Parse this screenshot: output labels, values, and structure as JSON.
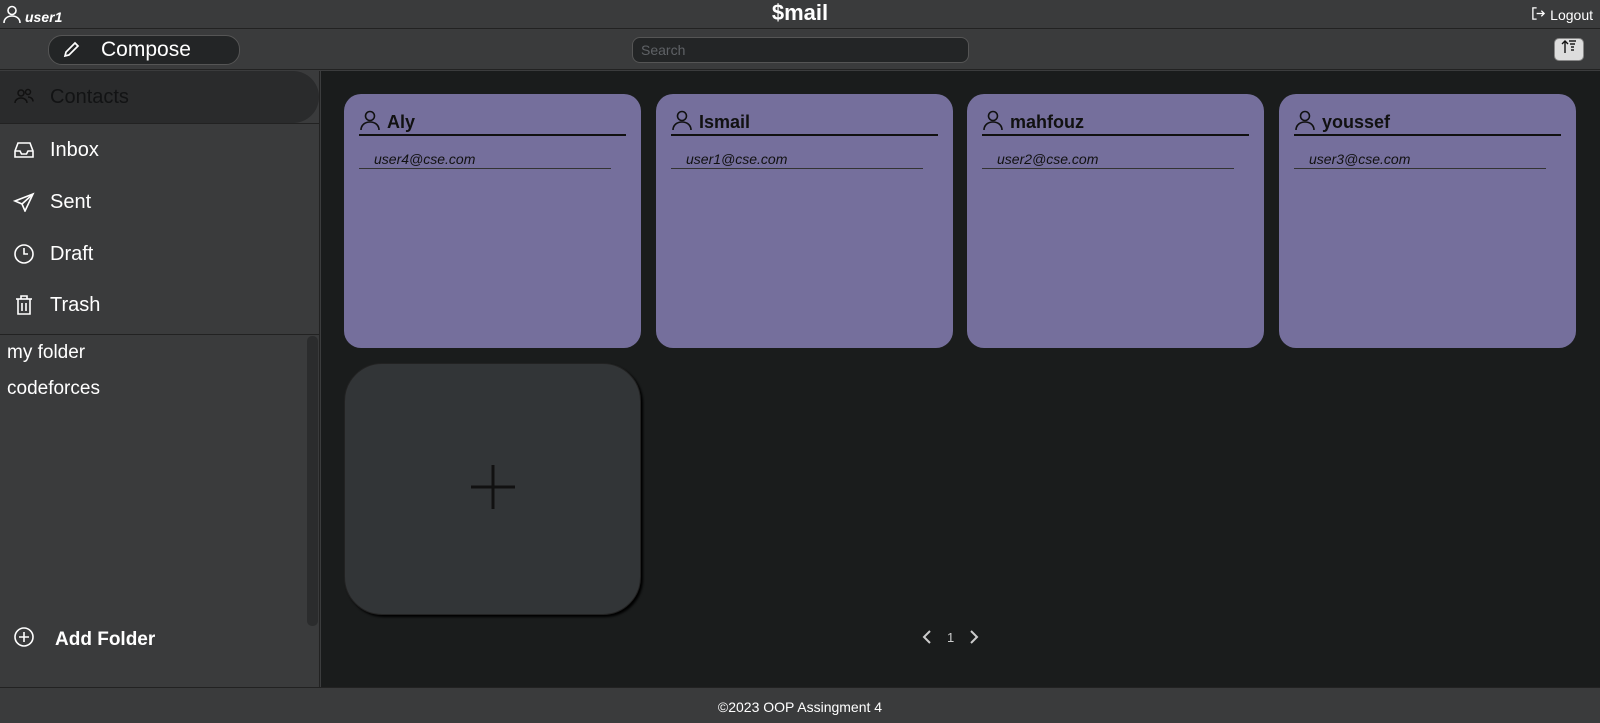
{
  "header": {
    "username": "user1",
    "logo": "$mail",
    "logout_label": "Logout"
  },
  "toolbar": {
    "compose_label": "Compose",
    "search_placeholder": "Search"
  },
  "sidebar": {
    "items": [
      {
        "label": "Contacts",
        "icon": "contacts-icon",
        "active": true
      },
      {
        "label": "Inbox",
        "icon": "inbox-icon"
      },
      {
        "label": "Sent",
        "icon": "send-icon"
      },
      {
        "label": "Draft",
        "icon": "clock-icon"
      },
      {
        "label": "Trash",
        "icon": "trash-icon"
      }
    ],
    "folders": [
      "my folder",
      "codeforces"
    ],
    "add_folder_label": "Add Folder"
  },
  "contacts": [
    {
      "name": "Aly",
      "email": "user4@cse.com"
    },
    {
      "name": "Ismail",
      "email": "user1@cse.com"
    },
    {
      "name": "mahfouz",
      "email": "user2@cse.com"
    },
    {
      "name": "youssef",
      "email": "user3@cse.com"
    }
  ],
  "pagination": {
    "page": "1"
  },
  "footer": {
    "text": "©2023 OOP Assingment 4"
  },
  "colors": {
    "background": "#1a1c1c",
    "bar": "#3a3b3c",
    "card": "#756f9c",
    "add_card": "#323537"
  }
}
